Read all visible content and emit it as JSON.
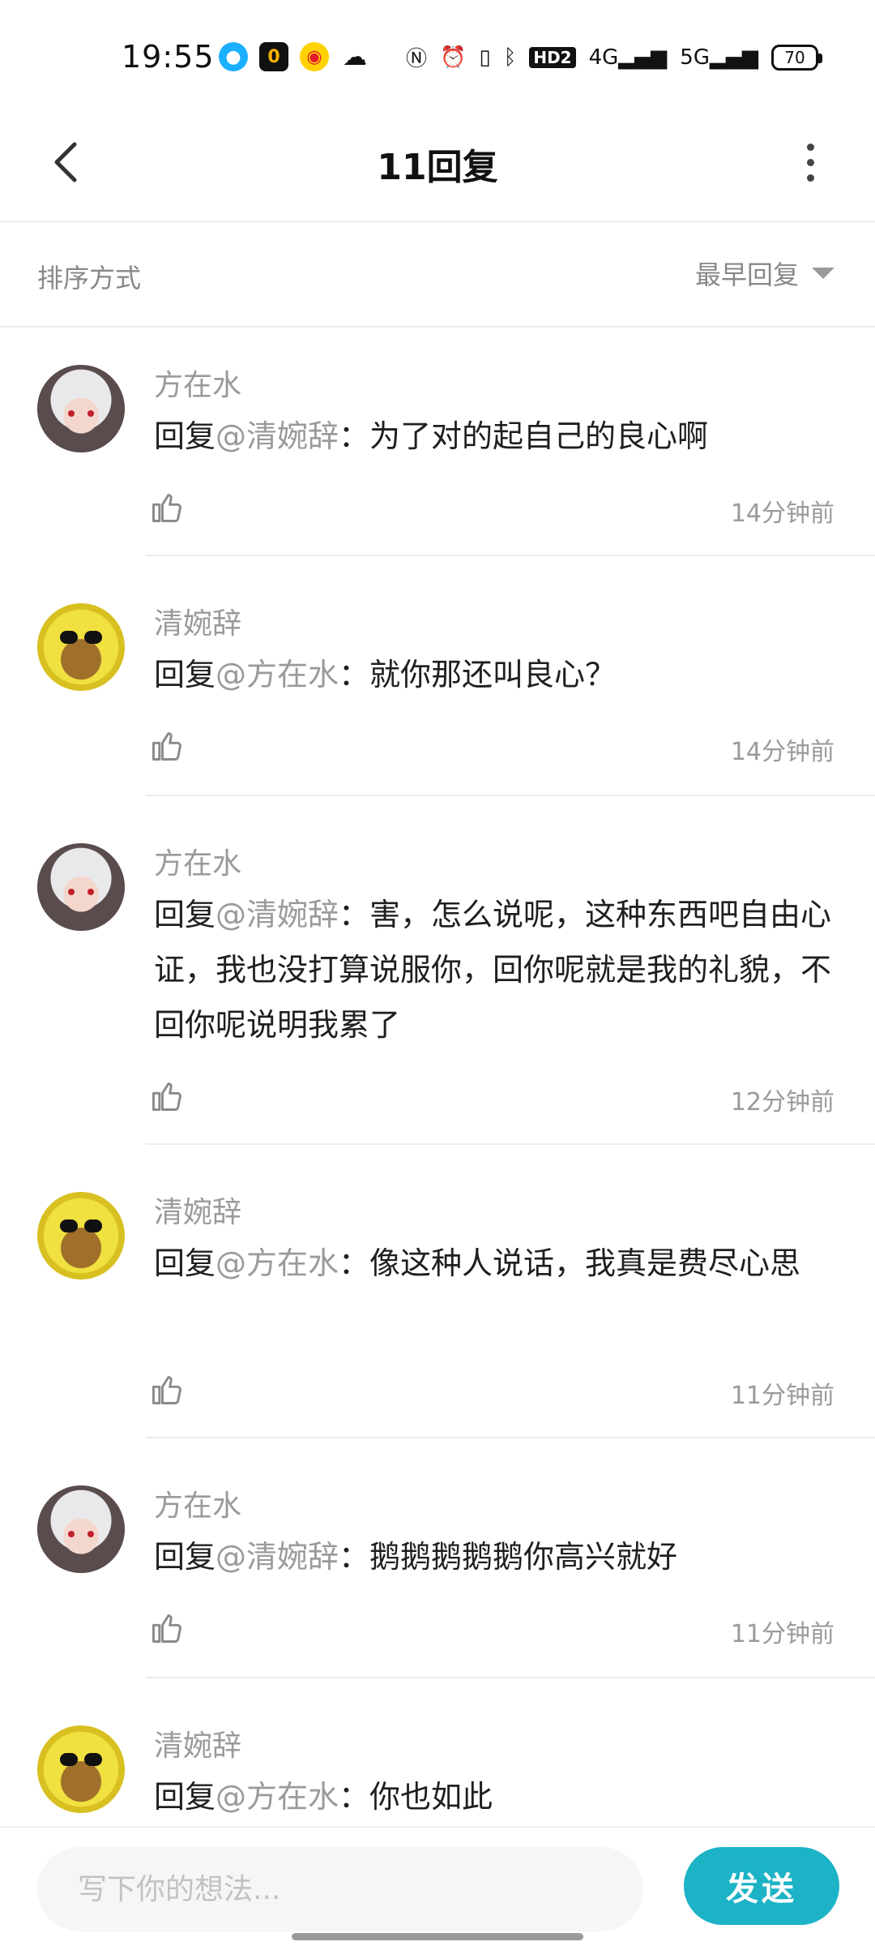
{
  "status_bar": {
    "time": "19:55",
    "battery": "70",
    "network_labels": [
      "HD2",
      "4G",
      "5G"
    ]
  },
  "header": {
    "title": "11回复"
  },
  "sort": {
    "label": "排序方式",
    "selected": "最早回复"
  },
  "comments": [
    {
      "author": "方在水",
      "prefix": "回复",
      "mention": "@清婉辞",
      "separator": "：",
      "text": "为了对的起自己的良心啊",
      "time": "14分钟前"
    },
    {
      "author": "清婉辞",
      "prefix": "回复",
      "mention": "@方在水",
      "separator": "：",
      "text": "就你那还叫良心？",
      "time": "14分钟前"
    },
    {
      "author": "方在水",
      "prefix": "回复",
      "mention": "@清婉辞",
      "separator": "：",
      "text": "害，怎么说呢，这种东西吧自由心证，我也没打算说服你，回你呢就是我的礼貌，不回你呢说明我累了",
      "time": "12分钟前"
    },
    {
      "author": "清婉辞",
      "prefix": "回复",
      "mention": "@方在水",
      "separator": "：",
      "text": "像这种人说话，我真是费尽心思",
      "time": "11分钟前"
    },
    {
      "author": "方在水",
      "prefix": "回复",
      "mention": "@清婉辞",
      "separator": "：",
      "text": "鹅鹅鹅鹅鹅你高兴就好",
      "time": "11分钟前"
    },
    {
      "author": "清婉辞",
      "prefix": "回复",
      "mention": "@方在水",
      "separator": "：",
      "text": "你也如此",
      "time": ""
    }
  ],
  "input": {
    "placeholder": "写下你的想法...",
    "value": ""
  },
  "send_button": {
    "label": "发送"
  },
  "colors": {
    "accent": "#1cb3c6",
    "muted_text": "#9a9a9a",
    "divider": "#ececec"
  }
}
